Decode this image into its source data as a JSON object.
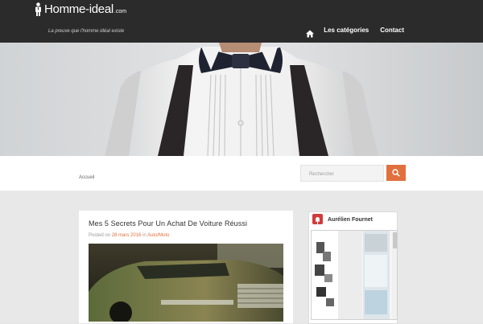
{
  "header": {
    "logo_main": "Homme-ideal",
    "logo_tld": ".com",
    "tagline": "La preuve que l'homme idéal existe"
  },
  "nav": {
    "home_icon": "home-icon",
    "items": [
      "Les catégories",
      "Contact"
    ]
  },
  "breadcrumb": "Accueil",
  "search": {
    "placeholder": "Rechercher",
    "button_icon": "search-icon"
  },
  "post": {
    "title": "Mes 5 Secrets Pour Un Achat De Voiture Réussi",
    "meta_prefix": "Posted on",
    "date": "28 mars 2016",
    "meta_in": "in",
    "category": "Auto/Moto"
  },
  "sidebar": {
    "widget_title": "Aurélien Fournet",
    "widget_icon": "pin-icon"
  },
  "colors": {
    "header_bg": "#2b2b2b",
    "accent": "#e0703d",
    "widget_icon_bg": "#d23b3b"
  }
}
